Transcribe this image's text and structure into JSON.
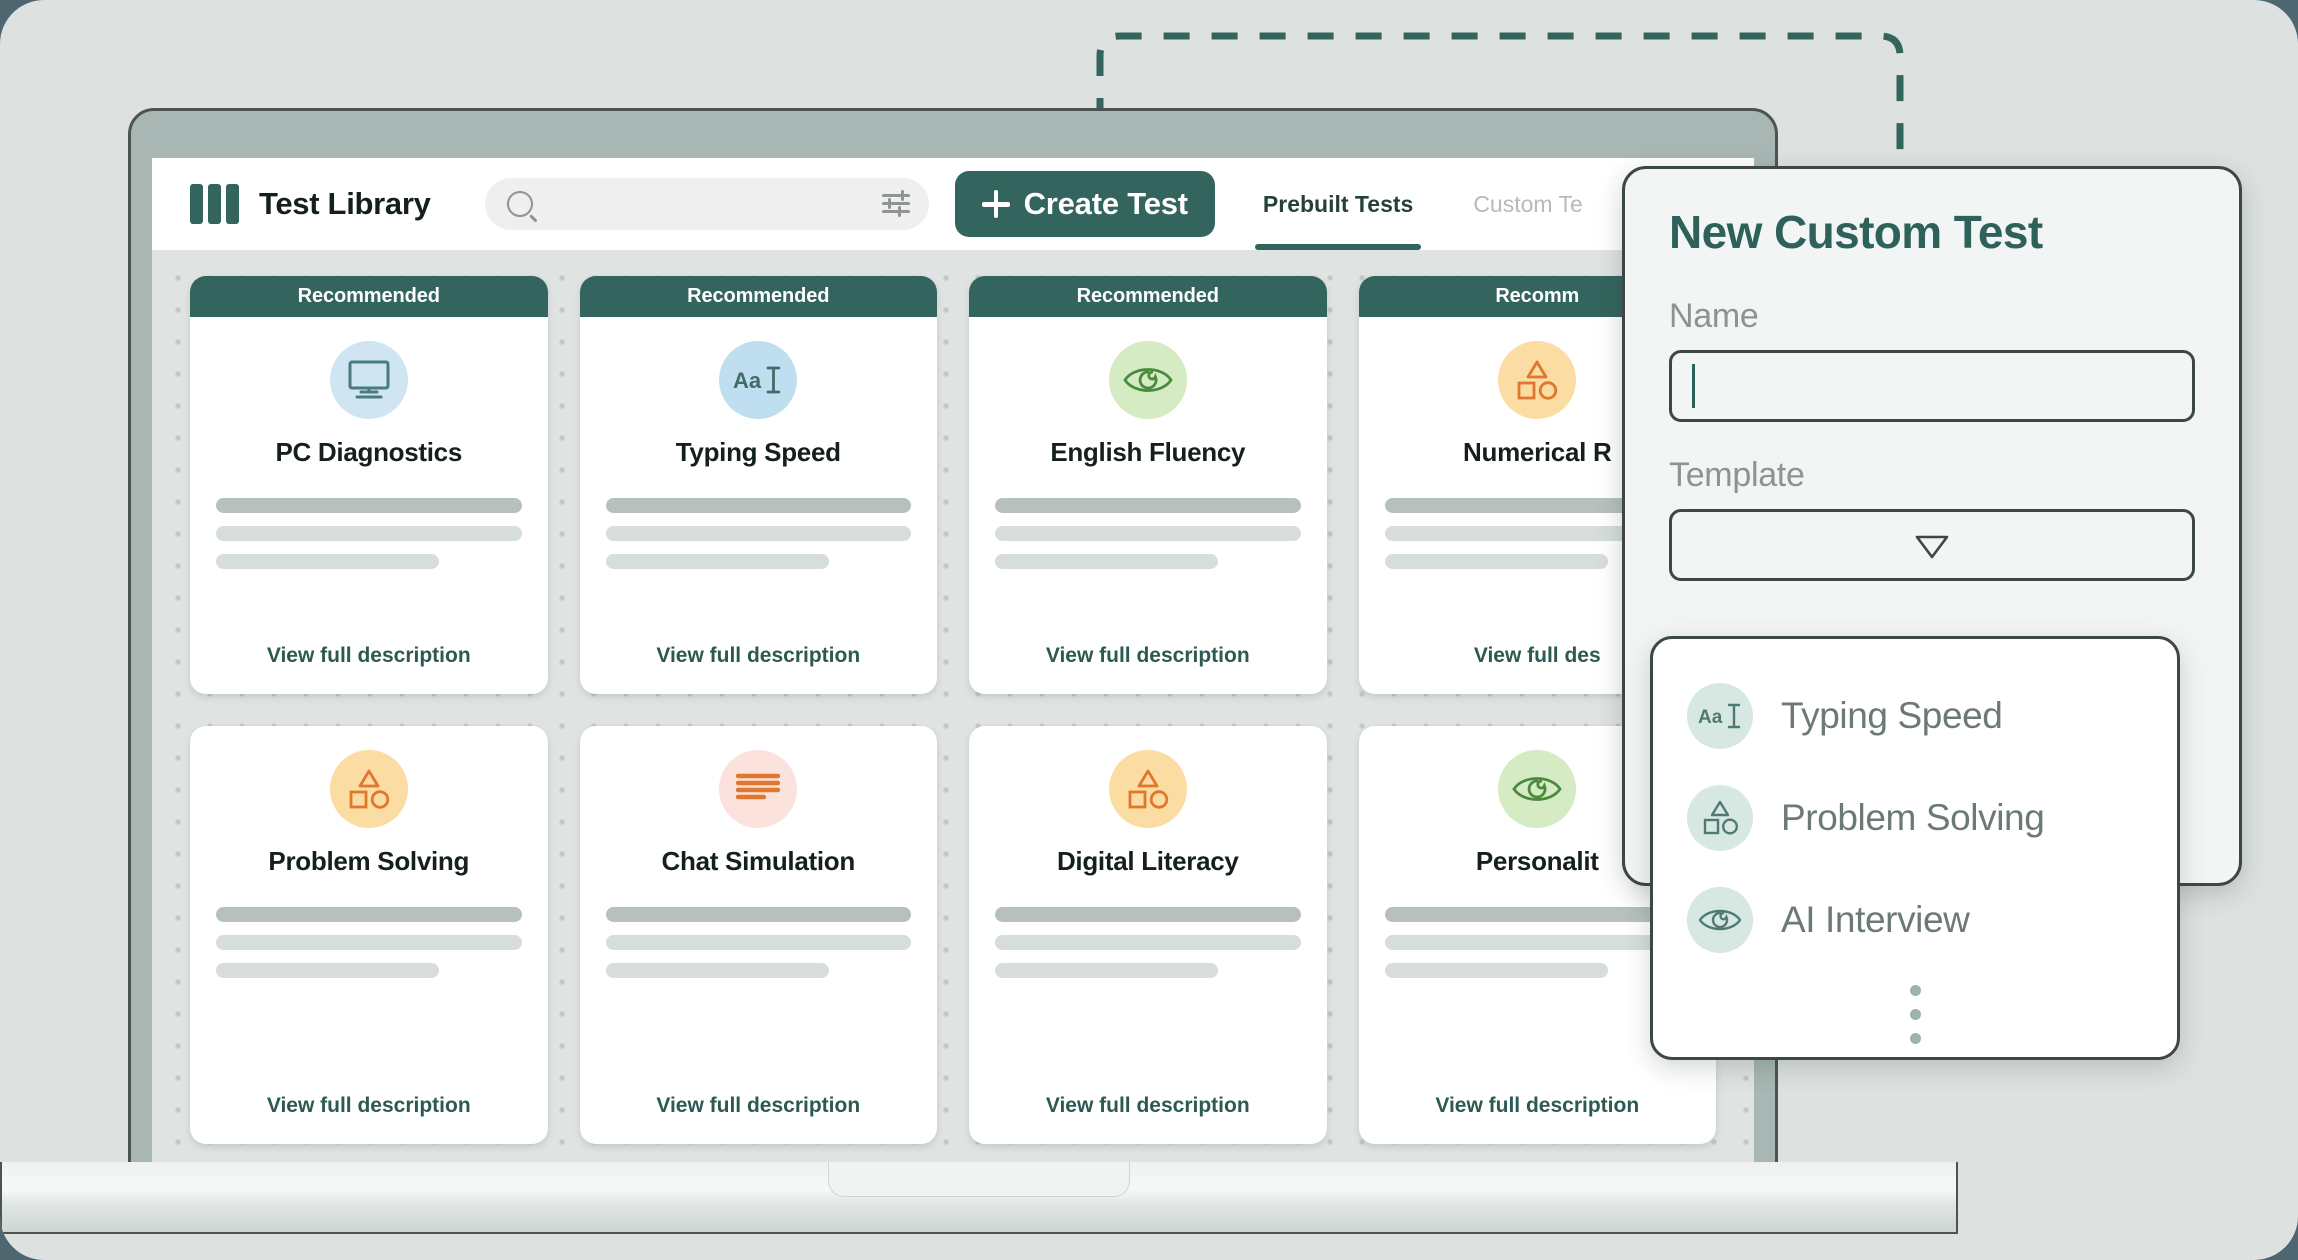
{
  "app": {
    "title": "Test Library",
    "logo_icon": "three-bars-logo-icon"
  },
  "search": {
    "value": "",
    "placeholder": "",
    "icon": "search-icon",
    "filter_icon": "sliders-filter-icon"
  },
  "toolbar": {
    "create_test_label": "Create Test",
    "create_test_icon": "plus-icon",
    "accent_color": "#33645d"
  },
  "tabs": [
    {
      "label": "Prebuilt Tests",
      "active": true
    },
    {
      "label": "Custom Te",
      "active": false
    }
  ],
  "cards": [
    {
      "ribbon": "Recommended",
      "title": "PC Diagnostics",
      "icon": "monitor-icon",
      "icon_bg": "#cfe5f2",
      "icon_color": "#4a7a80",
      "cta": "View full description"
    },
    {
      "ribbon": "Recommended",
      "title": "Typing Speed",
      "icon": "text-cursor-icon",
      "icon_bg": "#bfdef0",
      "icon_color": "#3f6e6a",
      "cta": "View full description"
    },
    {
      "ribbon": "Recommended",
      "title": "English Fluency",
      "icon": "eye-icon",
      "icon_bg": "#d5ebc4",
      "icon_color": "#4a8a3c",
      "cta": "View full description"
    },
    {
      "ribbon": "Recomm",
      "title": "Numerical R",
      "icon": "shapes-icon",
      "icon_bg": "#fbdca2",
      "icon_color": "#e0772c",
      "cta": "View full des"
    },
    {
      "ribbon": "",
      "title": "Problem Solving",
      "icon": "shapes-icon",
      "icon_bg": "#fbdca2",
      "icon_color": "#e0772c",
      "cta": "View full description"
    },
    {
      "ribbon": "",
      "title": "Chat Simulation",
      "icon": "chat-lines-icon",
      "icon_bg": "#fbe2dd",
      "icon_color": "#e0772c",
      "cta": "View full description"
    },
    {
      "ribbon": "",
      "title": "Digital Literacy",
      "icon": "shapes-icon",
      "icon_bg": "#fbdca2",
      "icon_color": "#e0772c",
      "cta": "View full description"
    },
    {
      "ribbon": "",
      "title": "Personalit",
      "icon": "eye-icon",
      "icon_bg": "#d5ebc4",
      "icon_color": "#4a8a3c",
      "cta": "View full description"
    }
  ],
  "modal": {
    "title": "New Custom Test",
    "name_label": "Name",
    "name_value": "",
    "template_label": "Template",
    "template_value": "",
    "template_caret_icon": "chevron-down-icon"
  },
  "dropdown": {
    "options": [
      {
        "label": "Typing Speed",
        "icon": "text-cursor-icon"
      },
      {
        "label": "Problem Solving",
        "icon": "shapes-icon"
      },
      {
        "label": "AI Interview",
        "icon": "eye-icon"
      }
    ],
    "more_icon": "vertical-ellipsis-icon"
  },
  "connector": {
    "style": "dashed",
    "color": "#33645d"
  }
}
